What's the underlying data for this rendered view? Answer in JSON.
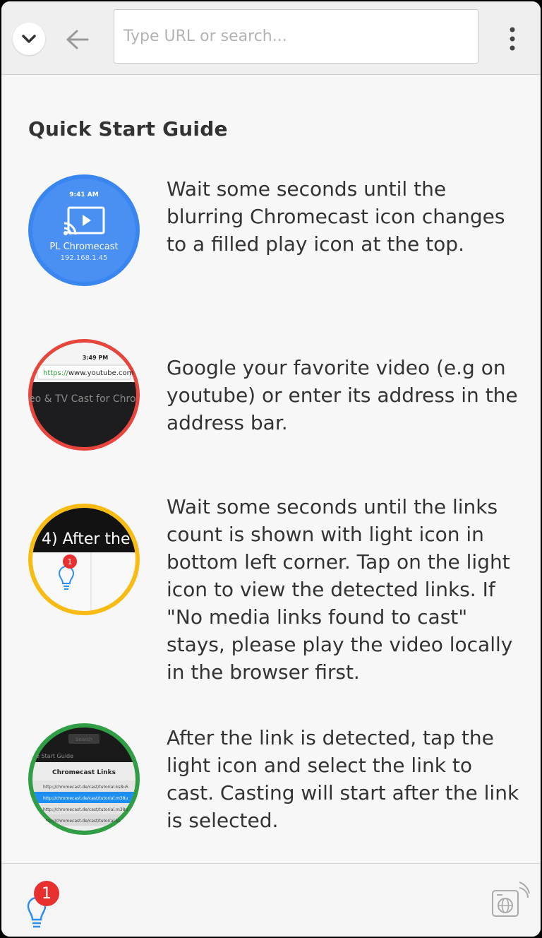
{
  "toolbar": {
    "url_placeholder": "Type URL or search..."
  },
  "guide": {
    "title": "Quick Start Guide",
    "steps": [
      {
        "text": "Wait some seconds until the blurring Chromecast icon changes to a filled play icon at the top.",
        "ring_color": "#3a86f0",
        "thumb_time": "9:41 AM",
        "thumb_device": "PL Chromecast",
        "thumb_ip": "192.168.1.45"
      },
      {
        "text": "Google your favorite video (e.g on youtube) or enter its address in the address bar.",
        "ring_color": "#e8453c",
        "thumb_time": "3:49 PM",
        "thumb_url_scheme": "https://",
        "thumb_url_host": "www.youtube.com",
        "thumb_caption": "eo & TV Cast for Chro"
      },
      {
        "text": "Wait some seconds until the links count is shown with light icon in bottom left corner. Tap on the light icon to view the detected links. If \"No media links found to cast\" stays, please play the video locally in the browser first.",
        "ring_color": "#f7bb14",
        "thumb_caption": "4) After the",
        "thumb_badge": "1"
      },
      {
        "text": "After the link is detected, tap the light icon and select the link to cast. Casting will start after the link is selected.",
        "ring_color": "#2f9e44",
        "thumb_button": "Search",
        "thumb_heading": "e Start Guide",
        "thumb_title": "Chromecast Links",
        "thumb_links": [
          "http://chromecast.de/cast/tutorial.ks8u5",
          "http://chromecast.de/cast/tutorial.m38u",
          "http://chromecast.de/cast/tutorial.m38u",
          "http://chromecast.de/cast/tutorial.ks"
        ]
      }
    ]
  },
  "bottombar": {
    "links_count": "1"
  },
  "colors": {
    "accent_blue": "#3a86f0",
    "badge_red": "#e8312e",
    "bulb_blue": "#2a8ff0"
  }
}
